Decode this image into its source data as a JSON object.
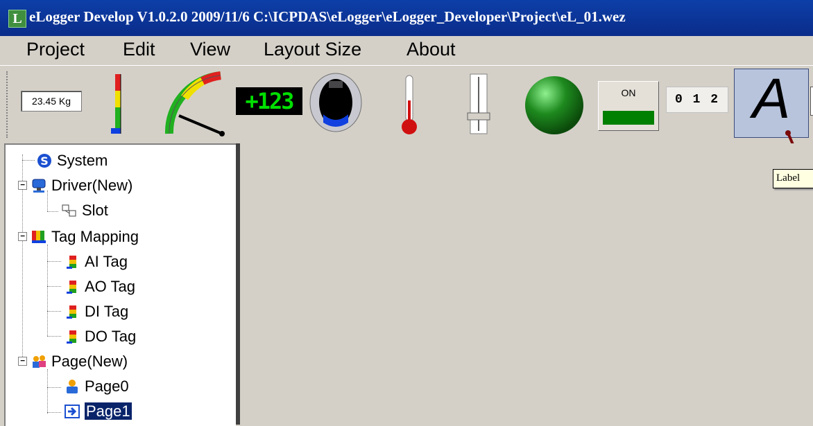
{
  "window": {
    "app_icon_letter": "L",
    "title": "eLogger Develop V1.0.2.0  2009/11/6  C:\\ICPDAS\\eLogger\\eLogger_Developer\\Project\\eL_01.wez"
  },
  "menu": {
    "items": [
      "Project",
      "Edit",
      "View",
      "Layout Size",
      "About"
    ]
  },
  "toolbar": {
    "weight_display": "23.45 Kg",
    "seven_segment": "+123",
    "on_button_label": "ON",
    "numeric_display": "0 1 2",
    "label_tool_glyph": "A"
  },
  "tooltip": {
    "text": "Label"
  },
  "tree": {
    "system": "System",
    "driver": "Driver(New)",
    "slot": "Slot",
    "tag_mapping": "Tag Mapping",
    "ai_tag": "AI Tag",
    "ao_tag": "AO Tag",
    "di_tag": "DI Tag",
    "do_tag": "DO Tag",
    "page": "Page(New)",
    "page0": "Page0",
    "page1": "Page1",
    "expander_symbol": "−"
  },
  "colors": {
    "title_bar": "#0a2c8a",
    "selection": "#0a246a",
    "on_indicator": "#008000",
    "led_green": "#1e8a1e",
    "seven_segment_green": "#00e000"
  },
  "icons": [
    "system-icon",
    "driver-icon",
    "slot-icon",
    "tag-mapping-icon",
    "tag-icon",
    "page-group-icon",
    "page-icon",
    "page-arrow-icon"
  ]
}
